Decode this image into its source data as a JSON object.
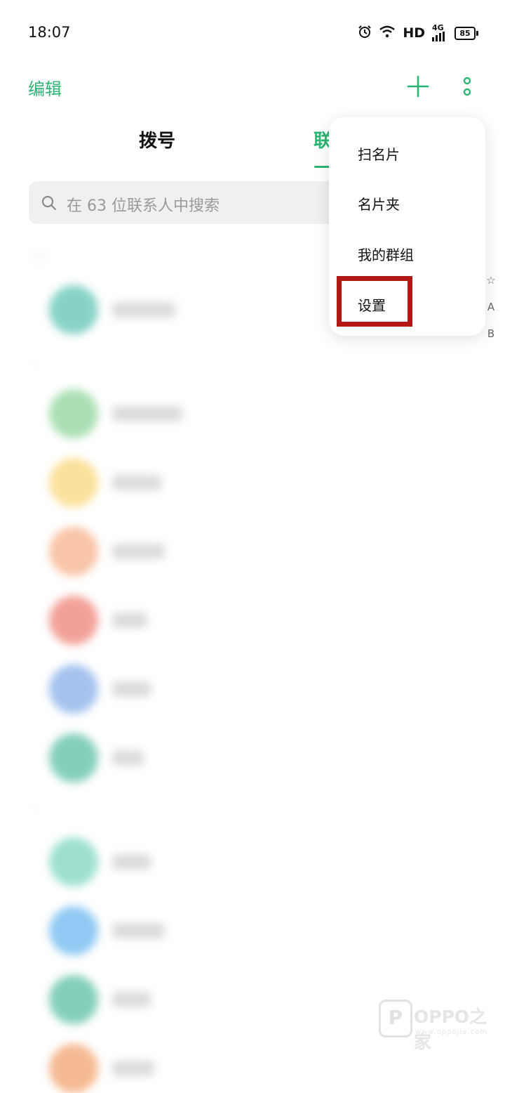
{
  "status_bar": {
    "time": "18:07",
    "network": "HD",
    "signal_label": "4G",
    "battery": "85"
  },
  "toolbar": {
    "edit_label": "编辑"
  },
  "tabs": [
    {
      "label": "拨号"
    },
    {
      "label": "联"
    }
  ],
  "search": {
    "placeholder": "在 63 位联系人中搜索"
  },
  "menu": {
    "items": [
      {
        "label": "扫名片"
      },
      {
        "label": "名片夹"
      },
      {
        "label": "我的群组"
      },
      {
        "label": "设置"
      }
    ]
  },
  "index_bar": [
    "☆",
    "A",
    "B"
  ],
  "contacts": {
    "avatar_colors": [
      "#5fc4b4",
      "#8fd59a",
      "#f9d77a",
      "#f7b18a",
      "#ee8276",
      "#86aee8",
      "#5cbfa6",
      "#7ed6c1",
      "#6bb8f0",
      "#5abfa3",
      "#f2a36f"
    ]
  },
  "watermark": {
    "brand": "OPPO之家",
    "url": "www.oppojia.com",
    "logo": "P"
  },
  "colors": {
    "accent": "#2bb673",
    "highlight": "#b31914"
  }
}
